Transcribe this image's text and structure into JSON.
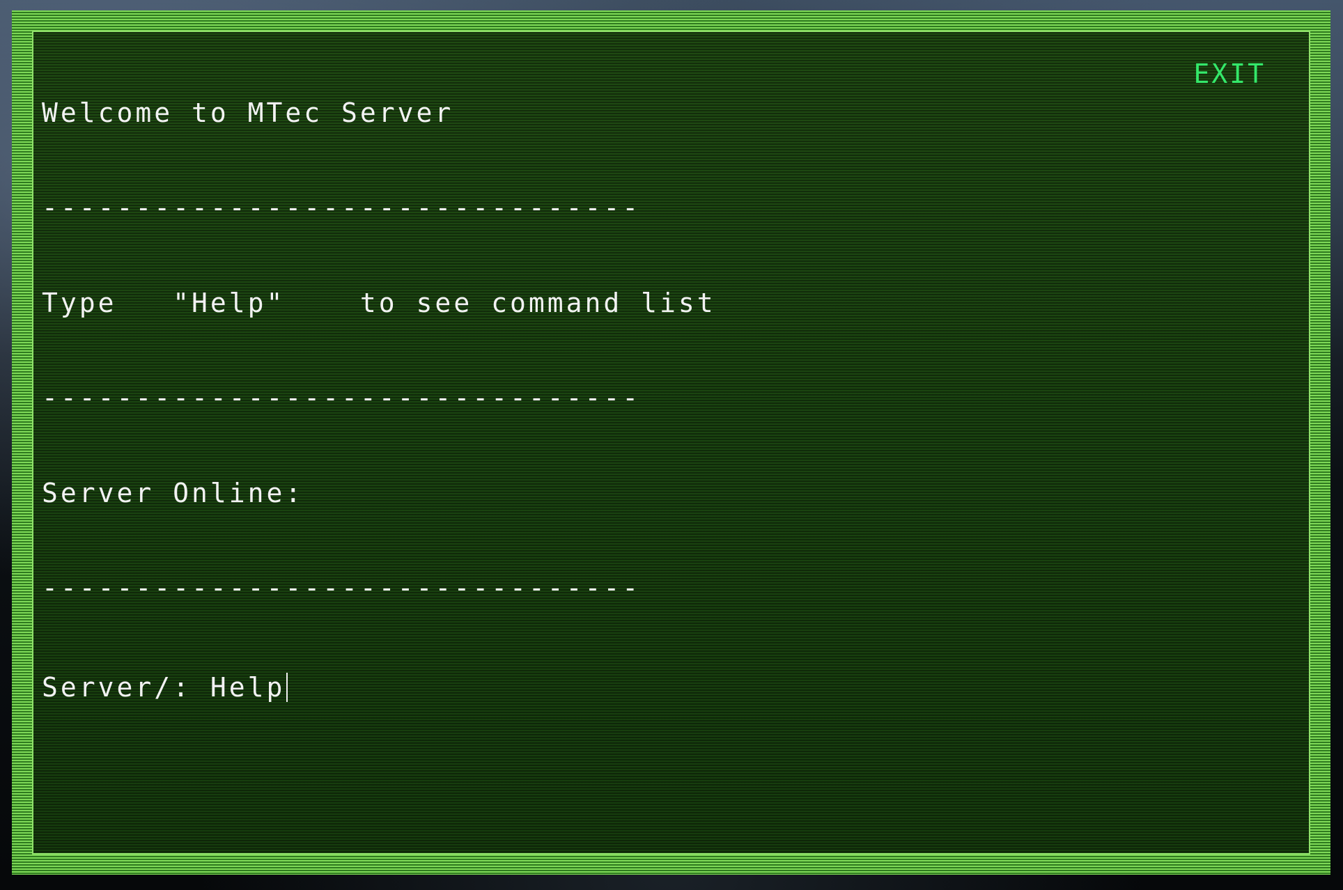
{
  "terminal": {
    "welcome": "Welcome to MTec Server",
    "separator": "--------------------------------",
    "help_hint": "Type   \"Help\"    to see command list",
    "status": "Server Online:",
    "prompt": "Server/: ",
    "input_value": "Help"
  },
  "controls": {
    "exit_label": "EXIT"
  },
  "colors": {
    "frame": "#7ed957",
    "screen": "#1a4410",
    "text": "#f2f2f2",
    "exit": "#34e86a"
  }
}
